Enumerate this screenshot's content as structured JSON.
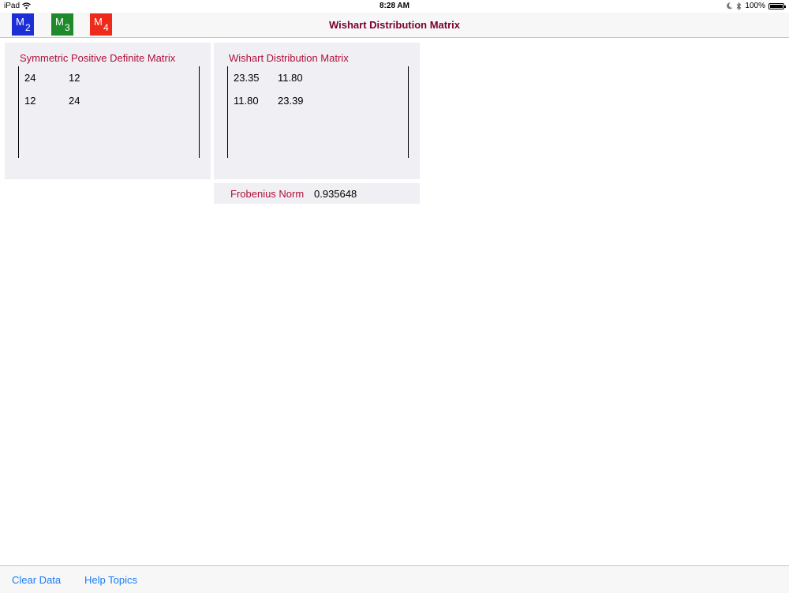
{
  "status_bar": {
    "device": "iPad",
    "time": "8:28 AM",
    "battery_text": "100%",
    "battery_level": 1.0
  },
  "nav": {
    "title": "Wishart Distribution Matrix",
    "buttons": [
      {
        "letter": "M",
        "sub": "2",
        "color": "#1c2fd6"
      },
      {
        "letter": "M",
        "sub": "3",
        "color": "#1f8a2a"
      },
      {
        "letter": "M",
        "sub": "4",
        "color": "#ee2a1a"
      }
    ]
  },
  "spd_panel": {
    "title": "Symmetric Positive Definite Matrix",
    "matrix": [
      [
        "24",
        "12"
      ],
      [
        "12",
        "24"
      ]
    ]
  },
  "wishart_panel": {
    "title": "Wishart Distribution Matrix",
    "matrix": [
      [
        "23.35",
        "11.80"
      ],
      [
        "11.80",
        "23.39"
      ]
    ]
  },
  "frobenius": {
    "label": "Frobenius Norm",
    "value": "0.935648"
  },
  "toolbar": {
    "clear_label": "Clear Data",
    "help_label": "Help Topics"
  },
  "colors": {
    "title_accent": "#7a0030",
    "panel_title": "#b0103a",
    "link_blue": "#1a7cf5"
  }
}
